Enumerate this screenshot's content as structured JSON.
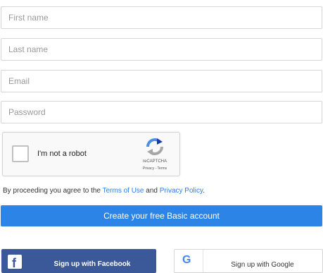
{
  "form": {
    "first_name": {
      "placeholder": "First name",
      "value": ""
    },
    "last_name": {
      "placeholder": "Last name",
      "value": ""
    },
    "email": {
      "placeholder": "Email",
      "value": ""
    },
    "password": {
      "placeholder": "Password",
      "value": ""
    }
  },
  "captcha": {
    "label": "I'm not a robot",
    "brand": "reCAPTCHA",
    "links": "Privacy - Terms",
    "checked": false,
    "icon": "recaptcha-logo-icon"
  },
  "terms": {
    "prefix": "By proceeding you agree to the ",
    "terms_link": "Terms of Use",
    "and": " and ",
    "privacy_link": "Privacy Policy",
    "suffix": "."
  },
  "create_button": {
    "label": "Create your free Basic account"
  },
  "social": {
    "facebook": {
      "label": "Sign up with Facebook",
      "icon": "facebook-icon",
      "icon_glyph": "f",
      "color": "#3b5998"
    },
    "google": {
      "label": "Sign up with Google",
      "icon": "google-icon",
      "icon_glyph": "G",
      "color": "#ffffff"
    }
  },
  "colors": {
    "primary": "#2d84e7",
    "link": "#2b7de9",
    "facebook": "#3b5998",
    "field_border": "#d6d6d6"
  }
}
